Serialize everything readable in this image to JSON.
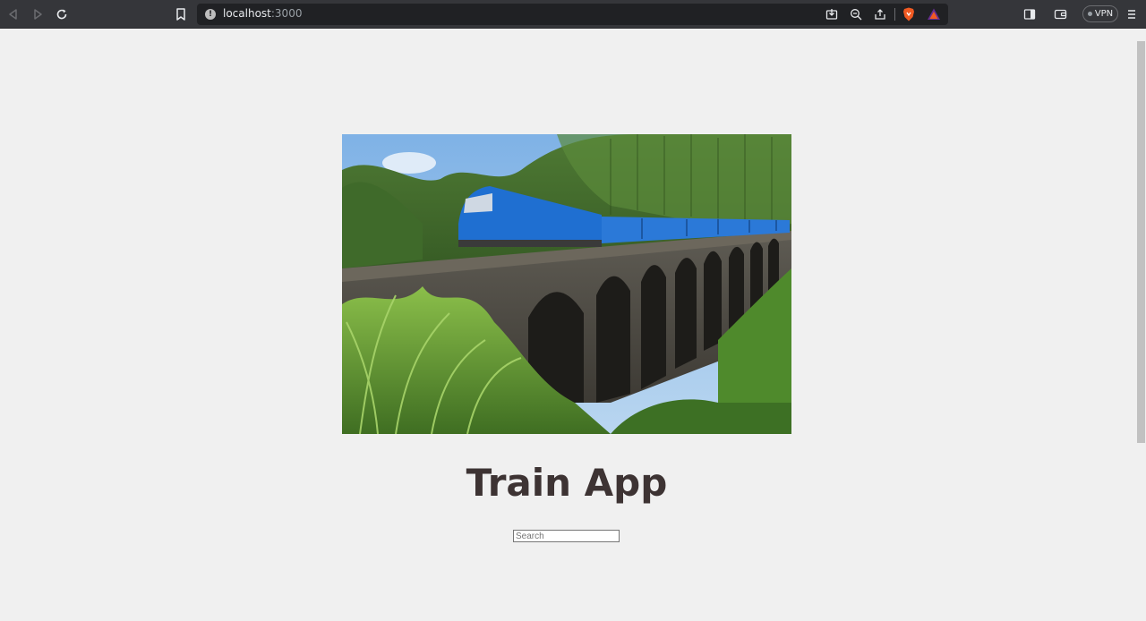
{
  "browser": {
    "url_host": "localhost",
    "url_port": ":3000",
    "vpn_label": "VPN"
  },
  "page": {
    "hero_image_alt": "Blue train crossing a stone arch bridge through a forest",
    "title": "Train App",
    "search": {
      "placeholder": "Search",
      "value": ""
    }
  },
  "colors": {
    "page_bg": "#f0f0f0",
    "title": "#3d3333",
    "toolbar": "#35363a",
    "omnibox": "#202124",
    "brave_orange": "#f15a22"
  },
  "icons": [
    "back-icon",
    "forward-icon",
    "reload-icon",
    "bookmark-icon",
    "info-icon",
    "install-icon",
    "zoom-out-icon",
    "share-icon",
    "brave-shields-icon",
    "brave-rewards-icon",
    "sidebar-icon",
    "wallet-icon",
    "menu-icon"
  ]
}
